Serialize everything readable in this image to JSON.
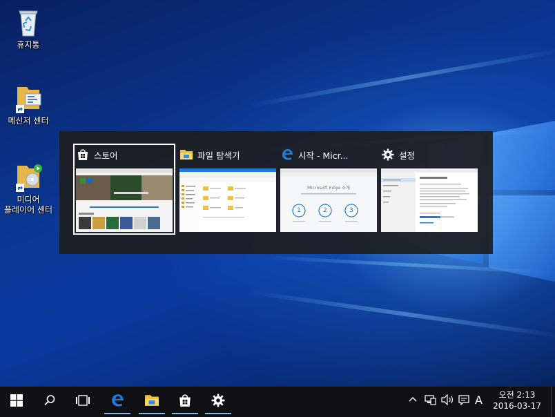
{
  "desktop_icons": [
    {
      "name": "recycle-bin",
      "label": "휴지통"
    },
    {
      "name": "messenger-center",
      "label": "메신저 센터"
    },
    {
      "name": "media-player-center",
      "label": "미디어\n플레이어 센터"
    }
  ],
  "task_switcher": {
    "cards": [
      {
        "title": "스토어",
        "icon": "store-icon",
        "selected": true
      },
      {
        "title": "파일 탐색기",
        "icon": "folder-icon",
        "selected": false
      },
      {
        "title": "시작 - Micr...",
        "icon": "edge-icon",
        "selected": false
      },
      {
        "title": "설정",
        "icon": "gear-icon",
        "selected": false
      }
    ],
    "edge_preview": {
      "heading": "Microsoft Edge 소개",
      "steps": [
        "1",
        "2",
        "3"
      ]
    }
  },
  "taskbar": {
    "buttons": [
      "start-icon",
      "search-icon",
      "task-view-icon",
      "edge-icon",
      "folder-icon",
      "store-icon",
      "gear-icon"
    ],
    "tray": {
      "input_indicator": "A"
    },
    "clock": {
      "time": "오전 2:13",
      "date": "2016-03-17"
    }
  },
  "colors": {
    "accent": "#7ab8ff",
    "switcher_bg": "#1e1e20",
    "taskbar_bg": "#101014",
    "edge_blue": "#1e7bd8"
  }
}
